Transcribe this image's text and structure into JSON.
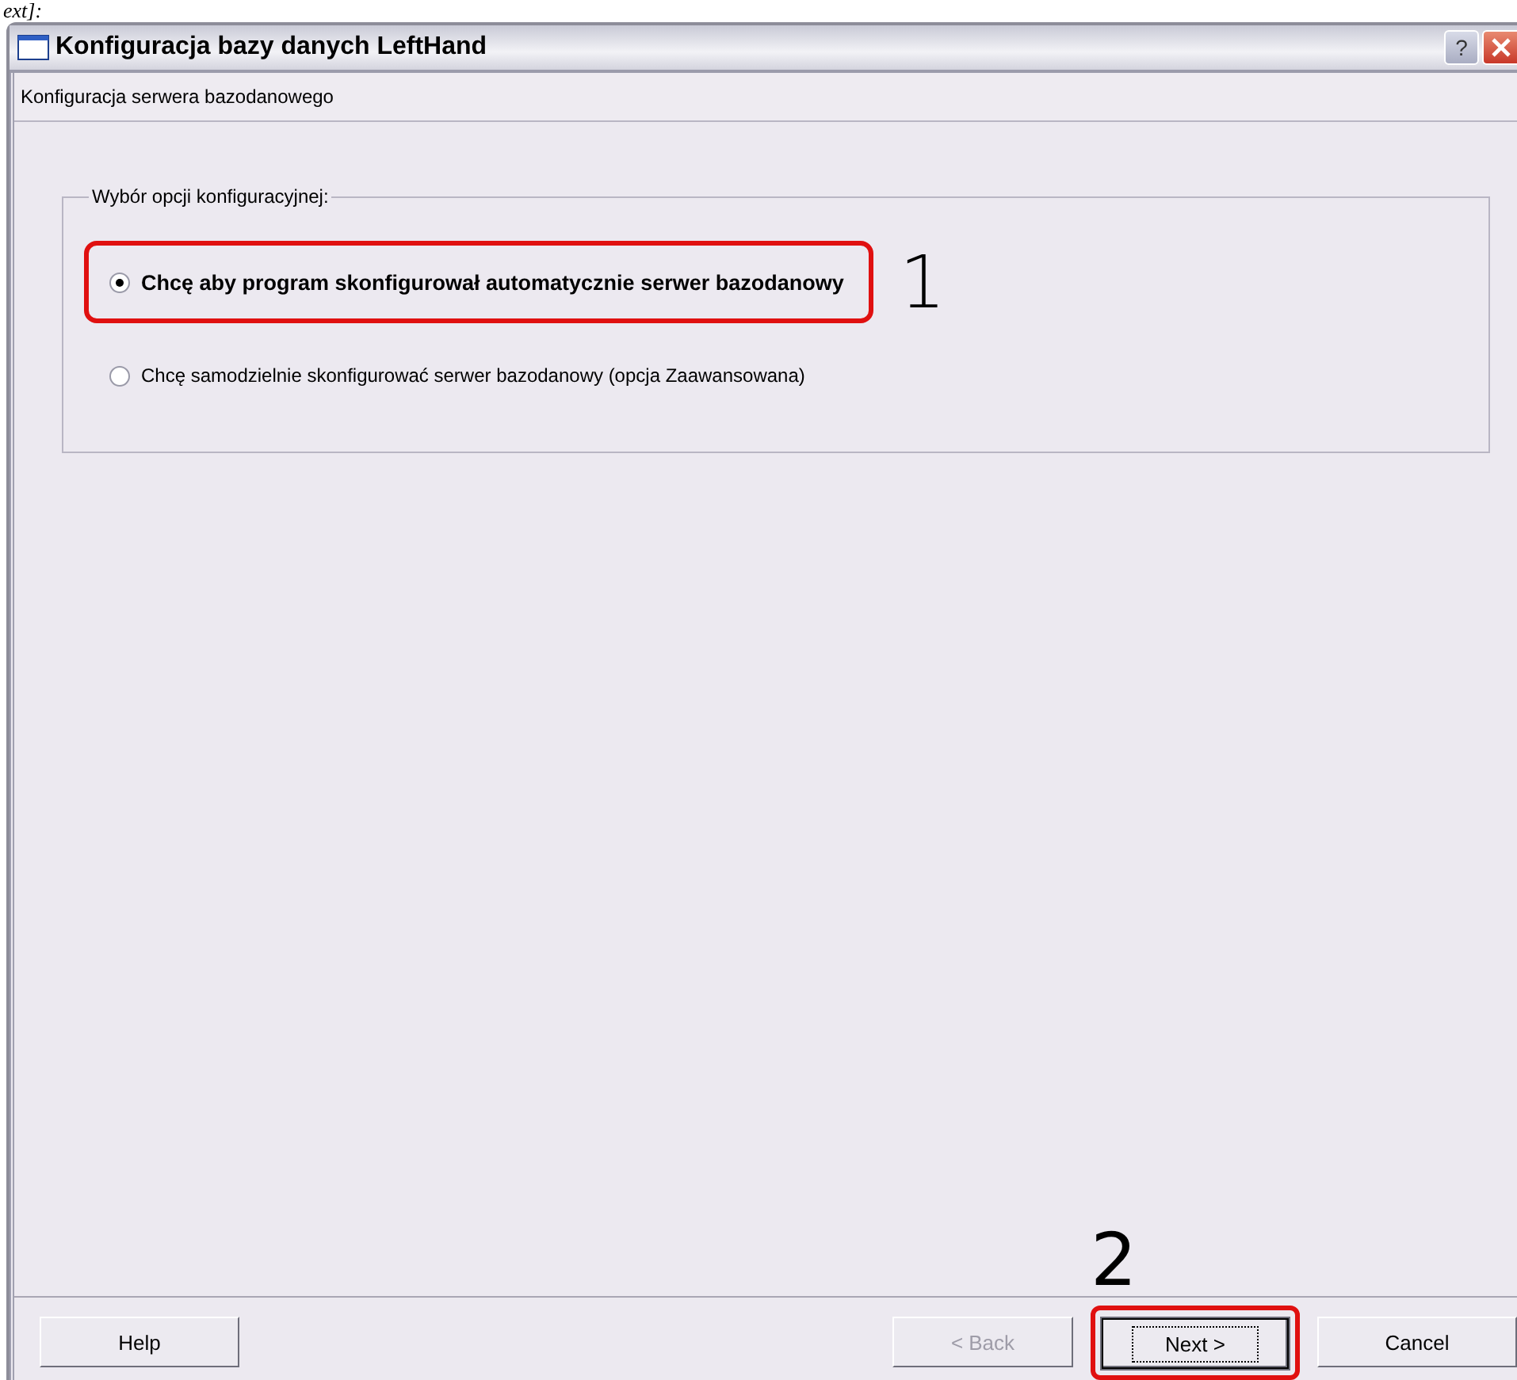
{
  "page_fragment": "ext]:",
  "window": {
    "title": "Konfiguracja bazy danych LeftHand",
    "title_buttons": [
      {
        "kind": "help",
        "label": "?"
      },
      {
        "kind": "close"
      }
    ]
  },
  "header": {
    "subtitle": "Konfiguracja serwera bazodanowego"
  },
  "group": {
    "legend": "Wybór opcji konfiguracyjnej:",
    "options": [
      {
        "label": "Chcę aby program skonfigurował automatycznie serwer bazodanowy",
        "selected": true,
        "bold": true,
        "callout": "1"
      },
      {
        "label": "Chcę samodzielnie skonfigurować serwer bazodanowy (opcja Zaawansowana)",
        "selected": false,
        "bold": false
      }
    ]
  },
  "buttons": [
    {
      "label": "Help",
      "disabled": false,
      "focused": false,
      "kind": "left"
    },
    {
      "label": "< Back",
      "disabled": true,
      "focused": false,
      "kind": "right"
    },
    {
      "label": "Next >",
      "disabled": false,
      "focused": true,
      "kind": "right",
      "callout": "2"
    },
    {
      "label": "Cancel",
      "disabled": false,
      "focused": false,
      "kind": "right"
    }
  ]
}
